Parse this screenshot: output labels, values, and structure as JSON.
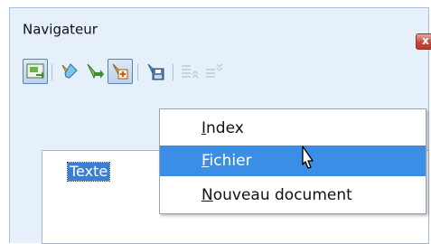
{
  "window": {
    "title": "Navigateur",
    "close_label": "x"
  },
  "toolbar": {
    "buttons": [
      {
        "name": "toggle-navigator-icon",
        "state": "pressed"
      },
      {
        "name": "edit-icon",
        "state": "normal"
      },
      {
        "name": "go-icon",
        "state": "normal"
      },
      {
        "name": "insert-icon",
        "state": "pressed"
      },
      {
        "name": "save-icon",
        "state": "normal"
      },
      {
        "name": "promote-icon",
        "state": "disabled"
      },
      {
        "name": "demote-icon",
        "state": "disabled"
      }
    ]
  },
  "tree": {
    "selected_item": "Texte"
  },
  "dropdown": {
    "items": [
      {
        "label_acc": "I",
        "label_rest": "ndex"
      },
      {
        "label_acc": "F",
        "label_rest": "ichier",
        "highlighted": true
      },
      {
        "label_acc": "N",
        "label_rest": "ouveau document"
      }
    ]
  },
  "colors": {
    "accent": "#3a8ee6",
    "panel": "#e6f0fb"
  }
}
